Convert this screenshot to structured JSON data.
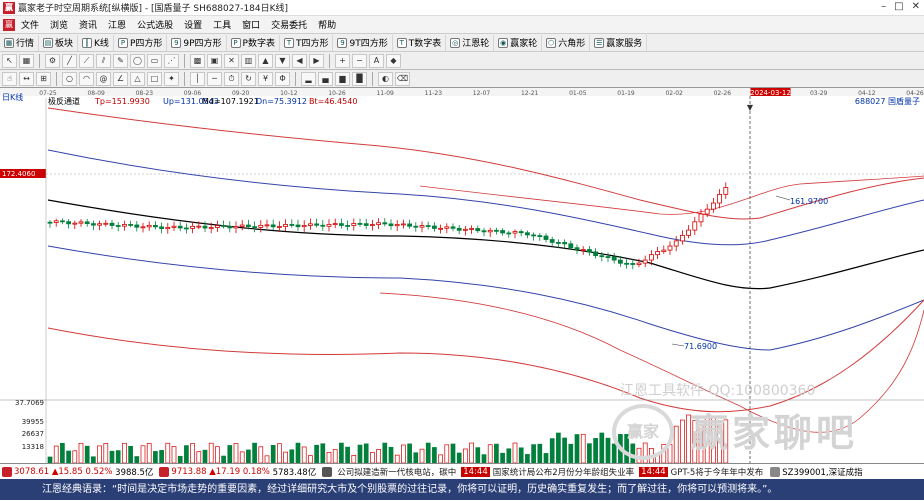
{
  "window": {
    "title": "赢家老子时空周期系统[纵横版] - [国盾量子   SH688027-184日K线]",
    "controls": [
      "–",
      "□",
      "✕"
    ]
  },
  "menu": {
    "items": [
      "文件",
      "浏览",
      "资讯",
      "江恩",
      "公式选股",
      "设置",
      "工具",
      "窗口",
      "交易委托",
      "帮助"
    ]
  },
  "nav": {
    "items": [
      {
        "label": "行情",
        "icon": "grid-icon"
      },
      {
        "label": "板块",
        "icon": "block-icon"
      },
      {
        "label": "K线",
        "icon": "candle-icon"
      },
      {
        "label": "P四方形",
        "icon": "square-icon"
      },
      {
        "label": "9P四方形",
        "icon": "square9-icon"
      },
      {
        "label": "P数字表",
        "icon": "number-table-icon"
      },
      {
        "label": "T四方形",
        "icon": "t-square-icon"
      },
      {
        "label": "9T四方形",
        "icon": "t-square9-icon"
      },
      {
        "label": "T数字表",
        "icon": "t-table-icon"
      },
      {
        "label": "江恩轮",
        "icon": "wheel-icon"
      },
      {
        "label": "赢家轮",
        "icon": "win-wheel-icon"
      },
      {
        "label": "六角形",
        "icon": "hexagon-icon"
      },
      {
        "label": "赢家服务",
        "icon": "service-icon"
      }
    ]
  },
  "chart": {
    "period_label": "日K线",
    "indicator": "极反通道",
    "stock": "688027 国盾量子",
    "params": {
      "tp": "Tp=151.9930",
      "up": "Up=131.0543",
      "md": "Md=107.1921",
      "dn": "Dn=75.3912",
      "bt": "Bt=46.4540"
    },
    "price_label_left": "172.4060",
    "annotations": {
      "high": "161.9700",
      "low": "71.6900"
    },
    "volume_labels": [
      "37.7069",
      "39955",
      "26637",
      "13318"
    ],
    "date_ticks": [
      "07-25",
      "08-09",
      "08-23",
      "09-06",
      "09-20",
      "10-12",
      "10-26",
      "11-09",
      "11-23",
      "12-07",
      "12-21",
      "01-05",
      "01-19",
      "02-02",
      "02-26",
      "2024-03-12",
      "03-29",
      "04-12",
      "04-26"
    ],
    "date_ticks_all": [
      "07-25",
      "08-09",
      "08-23",
      "09-06",
      "09-20",
      "10-12",
      "10-26",
      "11-09",
      "11-23",
      "12-07",
      "12-21",
      "01-05",
      "01-19",
      "02-02",
      "02-26",
      "2024-03-12",
      "03-29",
      "04-12",
      "04-26"
    ],
    "colors": {
      "bull": "#d60000",
      "bear": "#00803c",
      "outer": "#d23a3a",
      "inner": "#3344aa",
      "mid": "#000000",
      "cursor_tag": "#cc0000"
    }
  },
  "watermark": {
    "line1": "江恩工具软件   QQ:100800360",
    "line2": "赢家聊吧",
    "seal": "赢家"
  },
  "ticker": {
    "sh_index": "3078.61",
    "sh_change": "▲15.85",
    "sh_pct": "0.52%",
    "sh_amount": "3988.5亿",
    "sz_index": "9713.88",
    "sz_change": "▲17.19",
    "sz_pct": "0.18%",
    "sz_amount": "5783.48亿",
    "news1": "公司拟建造新一代核电站，碳中",
    "time1": "14:44",
    "news2": "国家统计局公布2月份分年龄组失业率",
    "time2": "14:44",
    "news3": "GPT-5将于今年年中发布",
    "index_code": "SZ399001,深证成指"
  },
  "quote": {
    "text": "江恩经典语录：“时间是决定市场走势的重要因素，经过详细研究大市及个别股票的过往记录，你将可以证明，历史确实重复发生；而了解过往，你将可以预测将来。”。"
  }
}
